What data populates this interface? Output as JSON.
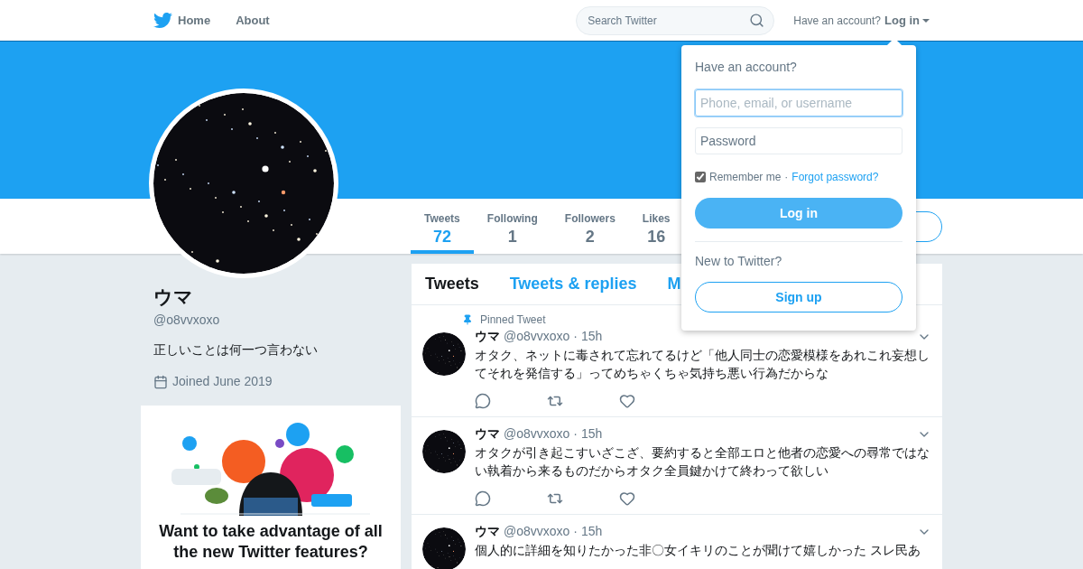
{
  "nav": {
    "links": [
      {
        "label": "Home"
      },
      {
        "label": "About"
      }
    ],
    "search": {
      "placeholder": "Search Twitter"
    },
    "account_prompt": "Have an account?",
    "login_menu": "Log in"
  },
  "profile_nav": {
    "stats": [
      {
        "label": "Tweets",
        "value": "72",
        "selected": true
      },
      {
        "label": "Following",
        "value": "1",
        "selected": false
      },
      {
        "label": "Followers",
        "value": "2",
        "selected": false
      },
      {
        "label": "Likes",
        "value": "16",
        "selected": false
      }
    ]
  },
  "profile": {
    "name": "ウマ",
    "handle": "@o8vvxoxo",
    "bio": "正しいことは何一つ言わない",
    "joined": "Joined June 2019"
  },
  "promo": {
    "title": "Want to take advantage of all the new Twitter features?"
  },
  "timeline": {
    "tabs": [
      {
        "label": "Tweets",
        "selected": true
      },
      {
        "label": "Tweets & replies",
        "selected": false
      },
      {
        "label": "M",
        "selected": false
      }
    ],
    "tweets": [
      {
        "pinned_label": "Pinned Tweet",
        "name": "ウマ",
        "handle": "@o8vvxoxo",
        "time": "· 15h",
        "text": "オタク、ネットに毒されて忘れてるけど「他人同士の恋愛模様をあれこれ妄想してそれを発信する」ってめちゃくちゃ気持ち悪い行為だからな"
      },
      {
        "name": "ウマ",
        "handle": "@o8vvxoxo",
        "time": "· 15h",
        "text": "オタクが引き起こすいざこざ、要約すると全部エロと他者の恋愛への尋常ではない執着から来るものだからオタク全員鍵かけて終わって欲しい"
      },
      {
        "name": "ウマ",
        "handle": "@o8vvxoxo",
        "time": "· 15h",
        "text": "個人的に詳細を知りたかった非〇女イキリのことが聞けて嬉しかった スレ民あ"
      }
    ]
  },
  "login_dropdown": {
    "title": "Have an account?",
    "username": {
      "placeholder": "Phone, email, or username",
      "focused": true
    },
    "password": {
      "placeholder": "Password"
    },
    "remember": {
      "label": "Remember me",
      "checked": true
    },
    "separator": "·",
    "forgot": "Forgot password?",
    "login_button": "Log in",
    "signup_prompt": "New to Twitter?",
    "signup_button": "Sign up"
  }
}
